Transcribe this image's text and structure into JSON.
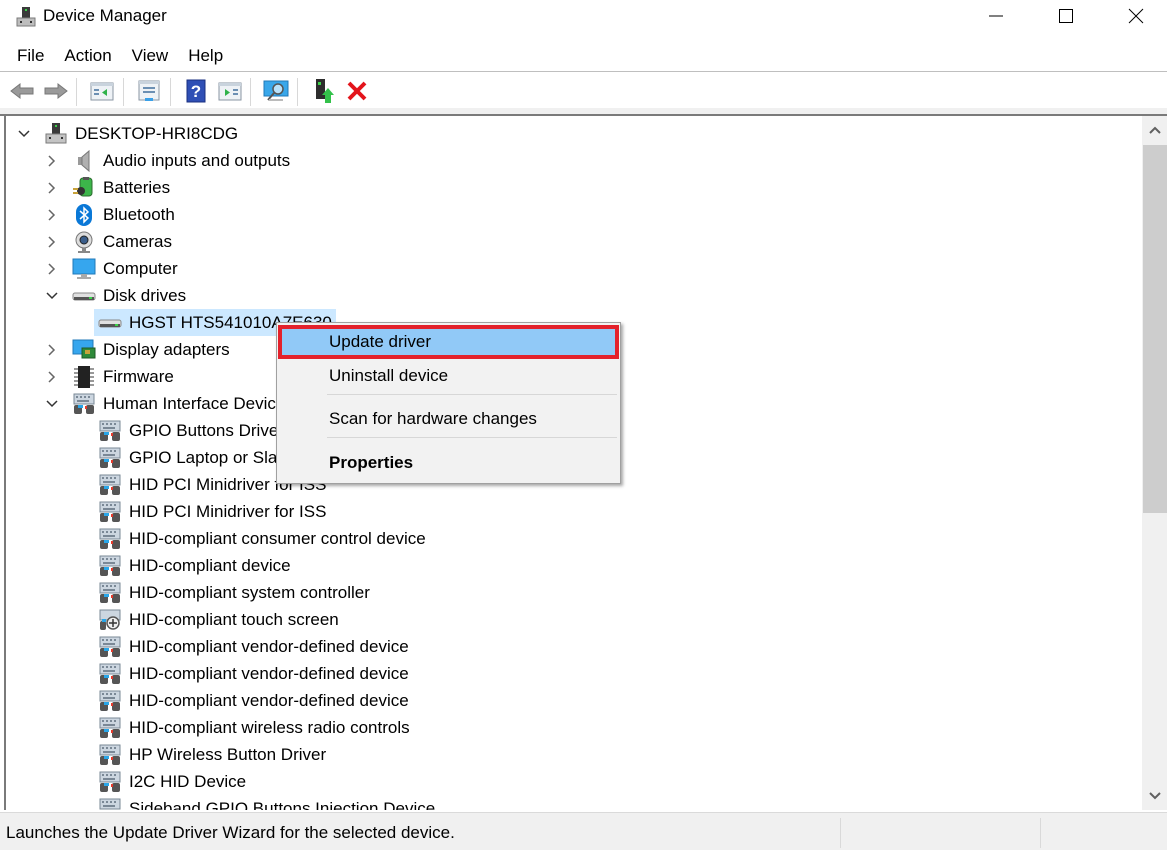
{
  "window": {
    "title": "Device Manager",
    "controls": {
      "minimize": "minimize",
      "maximize": "maximize",
      "close": "close"
    }
  },
  "menubar": {
    "items": [
      "File",
      "Action",
      "View",
      "Help"
    ]
  },
  "toolbar": {
    "buttons": [
      {
        "name": "back",
        "icon": "arrow-left-icon"
      },
      {
        "name": "forward",
        "icon": "arrow-right-icon"
      },
      {
        "name": "show-hide-console-tree",
        "icon": "console-tree-icon"
      },
      {
        "name": "properties",
        "icon": "properties-icon"
      },
      {
        "name": "help",
        "icon": "help-icon",
        "glyph": "?"
      },
      {
        "name": "show-hide-action-pane",
        "icon": "action-pane-icon"
      },
      {
        "name": "scan-for-hardware-changes",
        "icon": "scan-monitor-icon"
      },
      {
        "name": "update-driver",
        "icon": "update-driver-icon"
      },
      {
        "name": "uninstall-device",
        "icon": "red-x-icon",
        "glyph": "✖"
      }
    ]
  },
  "tree": {
    "root": {
      "label": "DESKTOP-HRI8CDG",
      "expanded": true,
      "icon": "computer-tower-icon"
    },
    "categories": [
      {
        "label": "Audio inputs and outputs",
        "icon": "speaker-icon",
        "expanded": false
      },
      {
        "label": "Batteries",
        "icon": "battery-icon",
        "expanded": false
      },
      {
        "label": "Bluetooth",
        "icon": "bluetooth-icon",
        "expanded": false
      },
      {
        "label": "Cameras",
        "icon": "camera-icon",
        "expanded": false
      },
      {
        "label": "Computer",
        "icon": "monitor-icon",
        "expanded": false
      },
      {
        "label": "Disk drives",
        "icon": "disk-drive-icon",
        "expanded": true,
        "children": [
          {
            "label": "HGST HTS541010A7E630",
            "icon": "disk-drive-icon",
            "selected": true
          }
        ]
      },
      {
        "label": "Display adapters",
        "icon": "display-adapter-icon",
        "expanded": false
      },
      {
        "label": "Firmware",
        "icon": "chip-icon",
        "expanded": false
      },
      {
        "label": "Human Interface Devices",
        "icon": "hid-icon",
        "expanded": true,
        "children": [
          {
            "label": "GPIO Buttons Driver",
            "icon": "hid-icon"
          },
          {
            "label": "GPIO Laptop or Slate Indicator Driver",
            "icon": "hid-icon"
          },
          {
            "label": "HID PCI Minidriver for ISS",
            "icon": "hid-icon"
          },
          {
            "label": "HID PCI Minidriver for ISS",
            "icon": "hid-icon"
          },
          {
            "label": "HID-compliant consumer control device",
            "icon": "hid-icon"
          },
          {
            "label": "HID-compliant device",
            "icon": "hid-icon"
          },
          {
            "label": "HID-compliant system controller",
            "icon": "hid-icon"
          },
          {
            "label": "HID-compliant touch screen",
            "icon": "touch-screen-icon"
          },
          {
            "label": "HID-compliant vendor-defined device",
            "icon": "hid-icon"
          },
          {
            "label": "HID-compliant vendor-defined device",
            "icon": "hid-icon"
          },
          {
            "label": "HID-compliant vendor-defined device",
            "icon": "hid-icon"
          },
          {
            "label": "HID-compliant wireless radio controls",
            "icon": "hid-icon"
          },
          {
            "label": "HP Wireless Button Driver",
            "icon": "hid-icon"
          },
          {
            "label": "I2C HID Device",
            "icon": "hid-icon"
          },
          {
            "label": "Sideband GPIO Buttons Injection Device",
            "icon": "hid-icon"
          }
        ]
      }
    ]
  },
  "context_menu": {
    "items": [
      {
        "label": "Update driver",
        "highlighted": true
      },
      {
        "label": "Uninstall device"
      },
      {
        "label": "Scan for hardware changes"
      },
      {
        "label": "Properties",
        "bold": true
      }
    ]
  },
  "scrollbar": {
    "position_fraction": 0.0,
    "visible_fraction": 0.55
  },
  "statusbar": {
    "text": "Launches the Update Driver Wizard for the selected device."
  },
  "colors": {
    "selection": "#cce8ff",
    "menu_highlight": "#91c9f7",
    "annotation_red": "#e3212b",
    "bluetooth_blue": "#0a78d7"
  }
}
